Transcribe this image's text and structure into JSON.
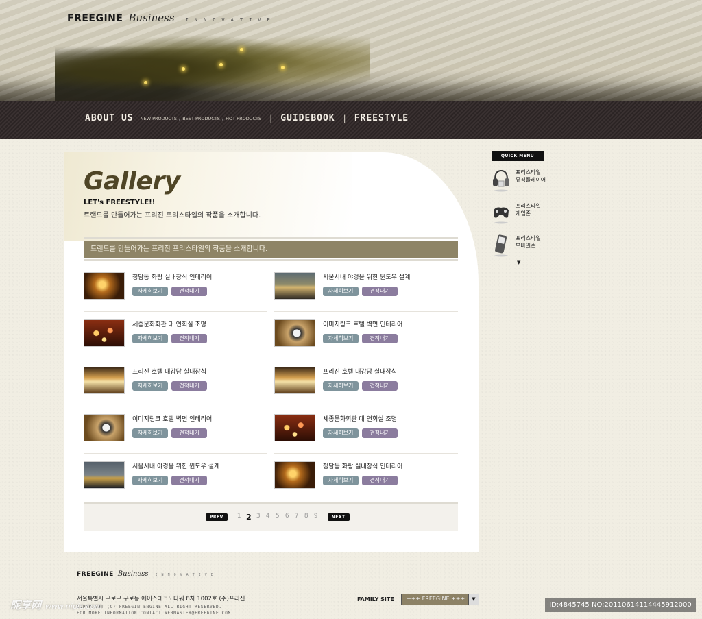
{
  "header": {
    "logo_word": "FREEGINE",
    "logo_script": "Business",
    "logo_tag": "INNOVATIVE"
  },
  "nav": {
    "about": "ABOUT US",
    "sub_items": [
      "NEW PRODUCTS",
      "BEST PRODUCTS",
      "HOT PRODUCTS"
    ],
    "guidebook": "GUIDEBOOK",
    "freestyle": "FREESTYLE"
  },
  "content": {
    "title": "Gallery",
    "subtitle": "LET's FREESTYLE!!",
    "description": "트랜드를 만들어가는 프리진 프리스타일의 작품을 소개합니다.",
    "bar_text": "트랜드를 만들어가는 프리진 프리스타일의 작품을 소개합니다.",
    "detail_label": "자세히보기",
    "quote_label": "견적내기"
  },
  "gallery": [
    {
      "title": "청담동 화랑 실내장식 인테리어",
      "thumb": "t-warm"
    },
    {
      "title": "서울시내 야경을 위한 윈도우 설계",
      "thumb": "t-city"
    },
    {
      "title": "세종문화회관 대 연회실 조명",
      "thumb": "t-orbs"
    },
    {
      "title": "이미지링크 호텔 벽면 인테리어",
      "thumb": "t-wall"
    },
    {
      "title": "프리진 호텔 대강당 실내장식",
      "thumb": "t-hall"
    },
    {
      "title": "프리진 호텔 대강당 실내장식",
      "thumb": "t-hall"
    },
    {
      "title": "이미지링크 호텔 벽면 인테리어",
      "thumb": "t-wall"
    },
    {
      "title": "세종문화회관 대 연회실 조명",
      "thumb": "t-orbs"
    },
    {
      "title": "서울시내 야경을 위한 윈도우 설계",
      "thumb": "t-night"
    },
    {
      "title": "청담동 화랑 실내장식 인테리어",
      "thumb": "t-warm"
    }
  ],
  "pagination": {
    "prev": "PREV",
    "next": "NEXT",
    "pages": [
      "1",
      "2",
      "3",
      "4",
      "5",
      "6",
      "7",
      "8",
      "9"
    ],
    "current": "2"
  },
  "quick_menu": {
    "title": "QUICK MENU",
    "items": [
      {
        "line1": "프리스타일",
        "line2": "뮤직플레이어",
        "icon": "headphones-icon"
      },
      {
        "line1": "프리스타일",
        "line2": "게임존",
        "icon": "gamepad-icon"
      },
      {
        "line1": "프리스타일",
        "line2": "모바일존",
        "icon": "mobile-phone-icon"
      }
    ],
    "more": "▼"
  },
  "footer": {
    "logo_word": "FREEGINE",
    "logo_script": "Business",
    "logo_tag": "INNOVATIVE",
    "address": "서울특별시 구로구 구로동 에이스테크노타워 8차 1002호 (주)프리진",
    "copyright_line1": "COPYRIGHT (C) FREEGIN ENGINE ALL RIGHT RESERVED.",
    "copyright_line2": "FOR MORE INFORMATION CONTACT WEBMASTER@FREEGINE.COM",
    "family_label": "FAMILY SITE",
    "family_value": "+++ FREEGINE +++"
  },
  "watermarks": {
    "left_brand": "昵享网",
    "left_url": "www.nipic.com",
    "right_id": "ID:4845745 NO:20110614114445912000"
  }
}
